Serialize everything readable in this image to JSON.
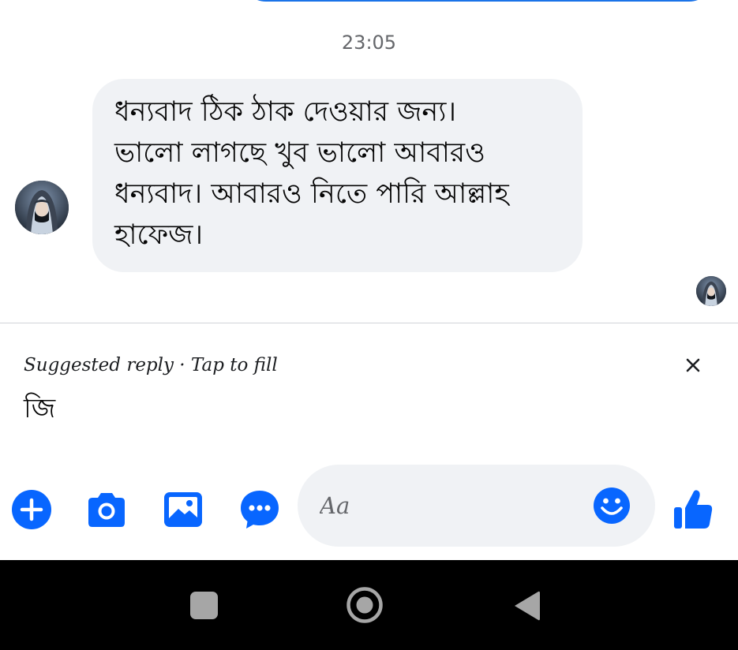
{
  "thread": {
    "timestamp": "23:05",
    "message": {
      "lines": [
        "ধন্যবাদ ঠিক ঠাক দেওয়ার জন্য।",
        "ভালো লাগছে খুব ভালো আবারও",
        "ধন্যবাদ। আবারও নিতে পারি আল্লাহ",
        "হাফেজ।"
      ]
    },
    "sender_avatar_icon": "avatar-hijab-icon",
    "seen_avatar_icon": "avatar-hijab-icon"
  },
  "suggested_reply": {
    "caption": "Suggested reply · Tap to fill",
    "text": "জি",
    "close_icon": "close-icon"
  },
  "composer": {
    "placeholder": "Aa",
    "tools": [
      "plus-circle-icon",
      "camera-icon",
      "image-icon",
      "more-chat-icon"
    ],
    "emoji_icon": "smiley-icon",
    "like_icon": "thumbs-up-icon"
  },
  "system_nav": {
    "recent_icon": "square-icon",
    "home_icon": "circle-icon",
    "back_icon": "triangle-back-icon"
  },
  "colors": {
    "accent": "#0866ff",
    "bubble_bg": "#f0f2f5",
    "timestamp": "#65676b",
    "nav_bg": "#000000"
  }
}
